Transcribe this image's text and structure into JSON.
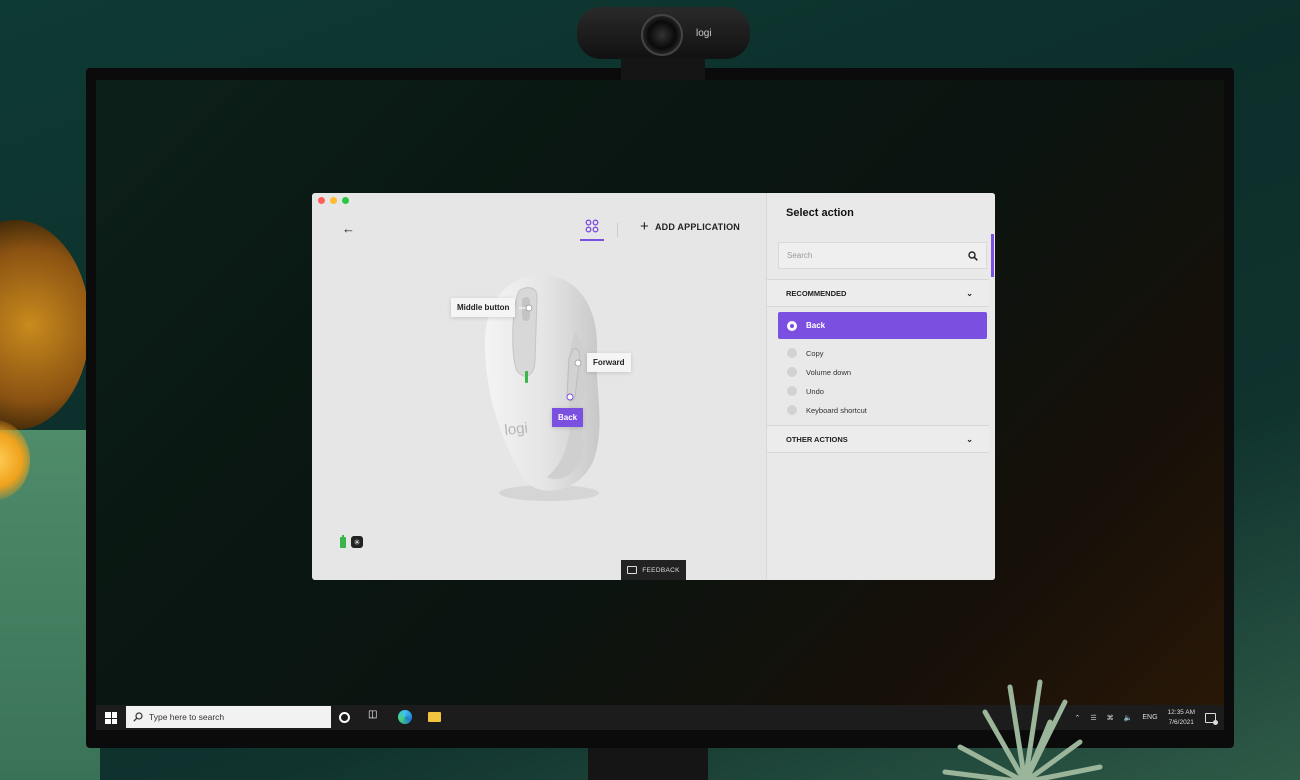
{
  "window": {
    "traffic_lights": [
      "#ff5f57",
      "#febc2e",
      "#28c840"
    ]
  },
  "toolbar": {
    "back_icon": "arrow-left-icon",
    "tab_icon": "device-grid-icon",
    "add_application_label": "ADD APPLICATION",
    "accent_color": "#7b4fe0"
  },
  "device": {
    "brand_text": "logi",
    "callouts": {
      "middle_button": "Middle button",
      "forward": "Forward",
      "back": "Back"
    },
    "status": {
      "battery_color": "#3ab54a",
      "connection_icon": "logi-bolt-icon"
    }
  },
  "feedback": {
    "label": "FEEDBACK"
  },
  "panel": {
    "title": "Select action",
    "search_placeholder": "Search",
    "recommended_label": "RECOMMENDED",
    "selected_action": "Back",
    "options": [
      "Copy",
      "Volume down",
      "Undo",
      "Keyboard shortcut"
    ],
    "other_actions_label": "OTHER ACTIONS"
  },
  "webcam": {
    "brand": "logi"
  },
  "taskbar": {
    "search_placeholder": "Type here to search",
    "language": "ENG",
    "time": "12:35 AM",
    "date": "7/6/2021"
  }
}
